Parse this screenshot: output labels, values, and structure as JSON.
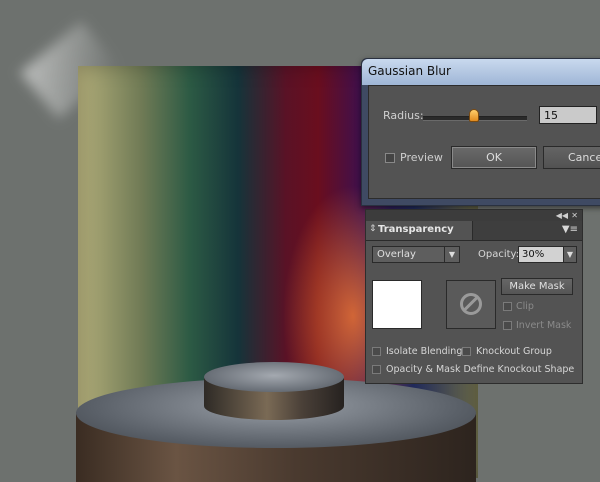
{
  "gaussian_blur": {
    "title": "Gaussian Blur",
    "radius_label": "Radius:",
    "radius_value": "15",
    "preview_label": "Preview",
    "preview_checked": false,
    "ok_label": "OK",
    "cancel_label": "Cancel"
  },
  "transparency": {
    "tab_label": "Transparency",
    "blend_mode": "Overlay",
    "opacity_label": "Opacity:",
    "opacity_value": "30%",
    "make_mask_label": "Make Mask",
    "clip_label": "Clip",
    "invert_mask_label": "Invert Mask",
    "isolate_blending_label": "Isolate Blending",
    "knockout_group_label": "Knockout Group",
    "opacity_mask_label": "Opacity & Mask Define Knockout Shape"
  },
  "icons": {
    "collapse": "double-chevron-left-icon",
    "close": "close-icon",
    "tab": "expand-arrows-icon",
    "menu": "panel-menu-icon",
    "dropdown": "triangle-down-icon",
    "no_mask": "prohibited-icon"
  },
  "colors": {
    "panel_bg": "#535353",
    "titlebar": "#b4c8e4",
    "slider_thumb": "#f0a040"
  }
}
